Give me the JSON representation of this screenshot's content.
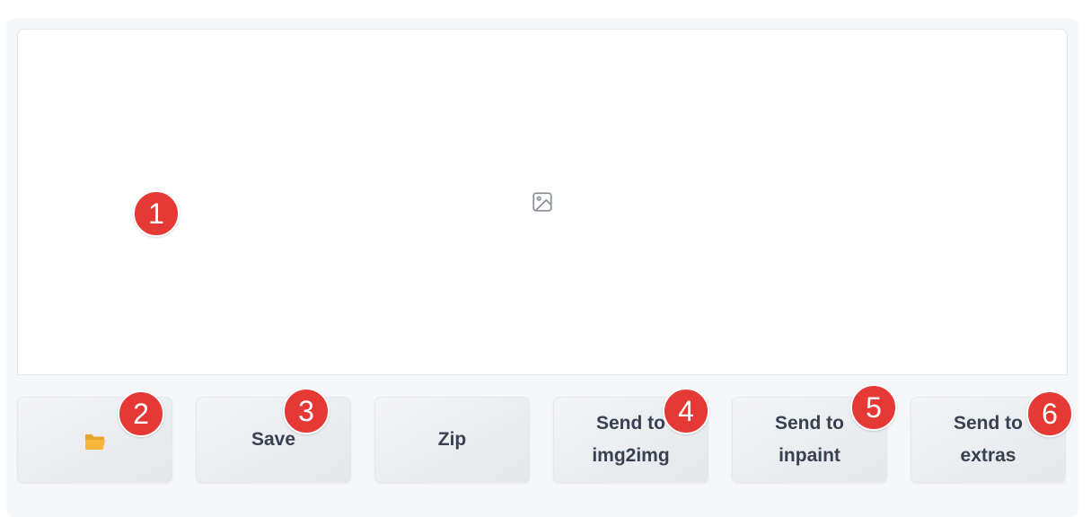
{
  "buttons": {
    "open_folder": {
      "icon": "folder-icon"
    },
    "save": {
      "label": "Save"
    },
    "zip": {
      "label": "Zip"
    },
    "send_img2img": {
      "label": "Send to\nimg2img"
    },
    "send_inpaint": {
      "label": "Send to\ninpaint"
    },
    "send_extras": {
      "label": "Send to\nextras"
    }
  },
  "gallery": {
    "placeholder_icon": "image-icon"
  },
  "annotations": [
    "1",
    "2",
    "3",
    "4",
    "5",
    "6"
  ],
  "colors": {
    "badge": "#e53935",
    "folder": "#f6b73c",
    "button_text": "#374151",
    "panel_bg": "#f6f7f9"
  }
}
